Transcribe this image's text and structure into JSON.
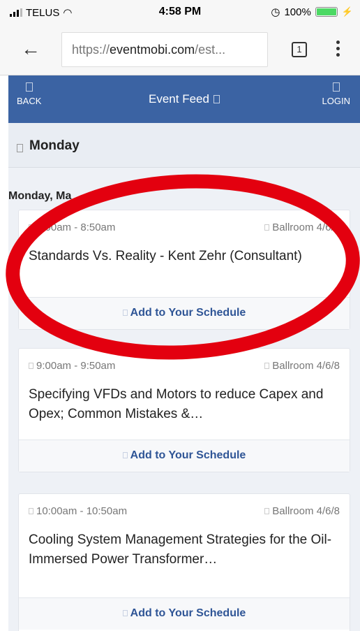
{
  "status_bar": {
    "carrier": "TELUS",
    "time": "4:58 PM",
    "battery": "100%",
    "battery_level": 1.0
  },
  "browser": {
    "url_scheme": "https://",
    "url_domain": "eventmobi.com",
    "url_rest": "/est...",
    "tab_count": "1"
  },
  "header": {
    "back_label": "BACK",
    "title": "Event Feed",
    "login_label": "LOGIN"
  },
  "day": {
    "label": "Monday",
    "date_line": "Monday, Ma"
  },
  "sessions": [
    {
      "time": "8:00am - 8:50am",
      "room": "Ballroom 4/6/8",
      "title": "Standards Vs. Reality - Kent Zehr (Consultant)",
      "action": "Add to Your Schedule"
    },
    {
      "time": "9:00am - 9:50am",
      "room": "Ballroom 4/6/8",
      "title": "Specifying VFDs and Motors to reduce Capex and Opex; Common Mistakes &…",
      "action": "Add to Your Schedule"
    },
    {
      "time": "10:00am - 10:50am",
      "room": "Ballroom 4/6/8",
      "title": "Cooling System Management Strategies for the Oil-Immersed Power Transformer…",
      "action": "Add to Your Schedule"
    }
  ],
  "colors": {
    "header_blue": "#3b63a3",
    "link_blue": "#2f5596",
    "annotation_red": "#e3000f"
  }
}
